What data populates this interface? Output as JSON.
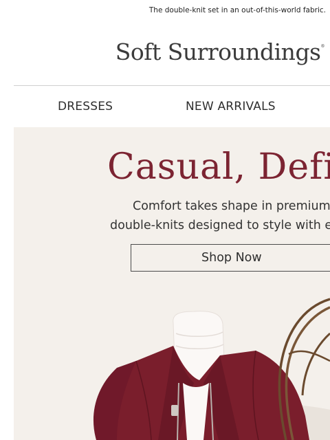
{
  "preheader": {
    "text": "The double-knit set in an out-of-this-world fabric."
  },
  "brand": {
    "name": "Soft Surroundings",
    "mark": "®"
  },
  "nav": {
    "items": [
      "DRESSES",
      "NEW ARRIVALS"
    ]
  },
  "hero": {
    "headline": "Casual, Define",
    "subcopy_line1": "Comfort takes shape in premium",
    "subcopy_line2": "double-knits designed to style with e",
    "cta": "Shop Now",
    "colors": {
      "background": "#f4f0eb",
      "headline": "#7c2432",
      "garment": "#7a1e2c"
    }
  }
}
